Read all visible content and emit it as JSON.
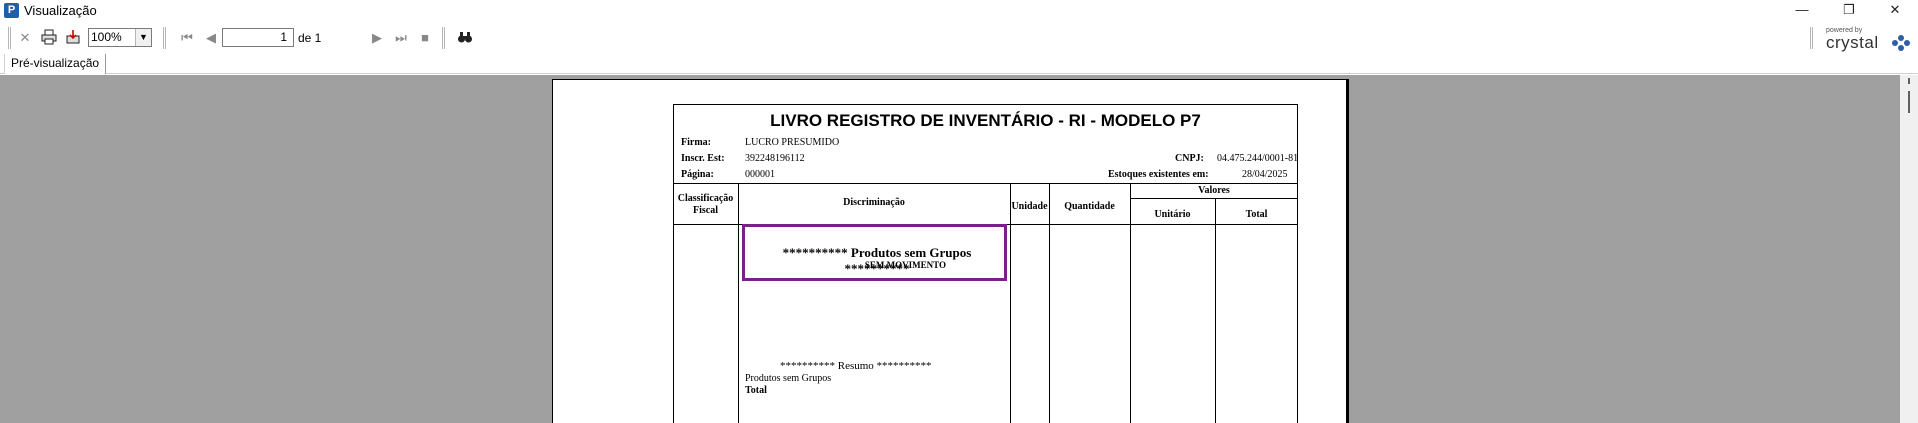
{
  "window": {
    "title": "Visualização",
    "app_icon": "P"
  },
  "toolbar": {
    "zoom_value": "100%",
    "page_current": "1",
    "page_of": "de 1"
  },
  "tabs": [
    {
      "label": "Pré-visualização"
    }
  ],
  "branding": {
    "powered": "powered by",
    "name": "crystal"
  },
  "report": {
    "title": "LIVRO REGISTRO DE INVENTÁRIO - RI - MODELO P7",
    "firma_label": "Firma:",
    "firma_value": "LUCRO PRESUMIDO",
    "inscr_label": "Inscr. Est:",
    "inscr_value": "392248196112",
    "cnpj_label": "CNPJ:",
    "cnpj_value": "04.475.244/0001-81",
    "pagina_label": "Página:",
    "pagina_value": "000001",
    "estoques_label": "Estoques existentes em:",
    "estoques_value": "28/04/2025",
    "columns": {
      "classificacao_line1": "Classificação",
      "classificacao_line2": "Fiscal",
      "discriminacao": "Discriminação",
      "unidade": "Unidade",
      "quantidade": "Quantidade",
      "valores": "Valores",
      "unitario": "Unitário",
      "total": "Total"
    },
    "group_title": "********** Produtos sem Grupos **********",
    "group_subtitle": "SEM MOVIMENTO",
    "resumo_title": "********** Resumo **********",
    "resumo_line1": "Produtos sem Grupos",
    "resumo_line2": "Total"
  },
  "colors": {
    "highlight": "#7b1f8a",
    "workspace": "#a0a0a0"
  }
}
